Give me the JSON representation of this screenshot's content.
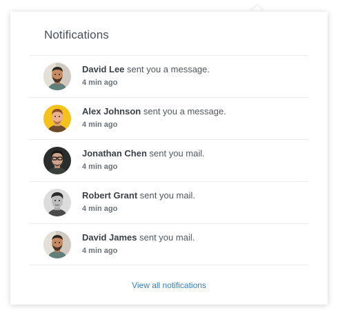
{
  "dropdown": {
    "title": "Notifications",
    "view_all": "View all notifications"
  },
  "notifications": [
    {
      "name": "David Lee",
      "action": "sent you a message.",
      "time": "4 min ago",
      "avatar": "man-beard-icon"
    },
    {
      "name": "Alex Johnson",
      "action": "sent you a message.",
      "time": "4 min ago",
      "avatar": "man-yellow-bg-icon"
    },
    {
      "name": "Jonathan Chen",
      "action": "sent you mail.",
      "time": "4 min ago",
      "avatar": "man-glasses-icon"
    },
    {
      "name": "Robert Grant",
      "action": "sent you mail.",
      "time": "4 min ago",
      "avatar": "man-grayscale-icon"
    },
    {
      "name": "David James",
      "action": "sent you mail.",
      "time": "4 min ago",
      "avatar": "man-beard-icon"
    }
  ],
  "colors": {
    "link": "#2f7fd8",
    "name_text": "#3b4047",
    "divider": "#ececee",
    "avatar_yellow": "#f4c21c"
  }
}
